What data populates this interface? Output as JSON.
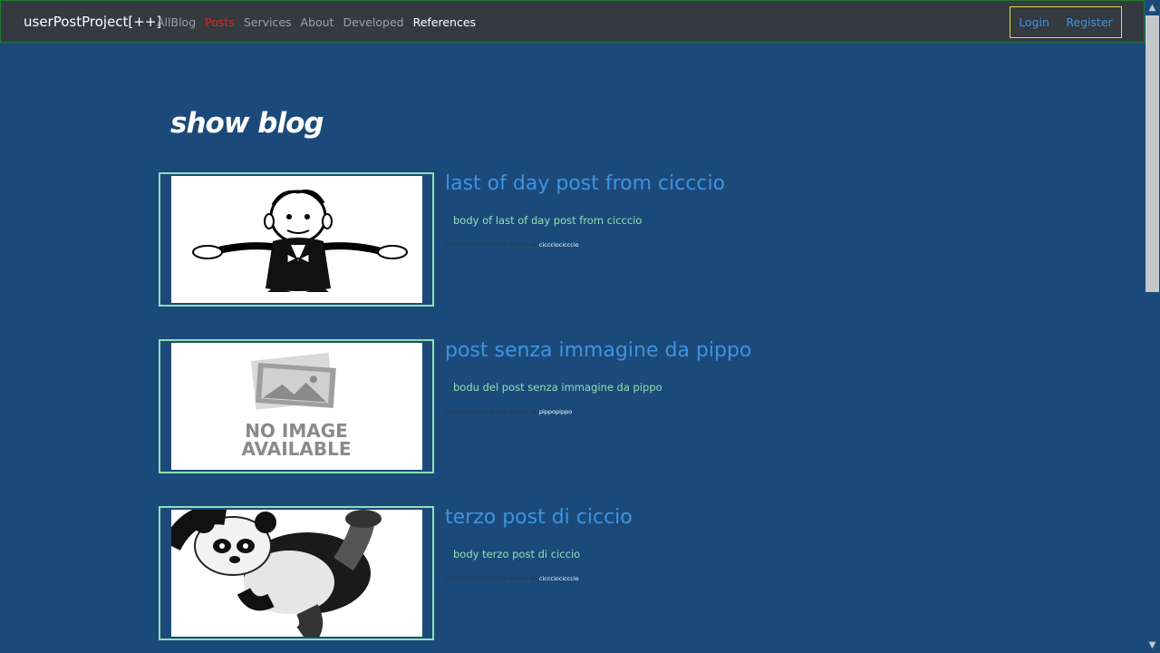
{
  "navbar": {
    "brand": "userPostProject[++]",
    "links": [
      "AllBlog",
      "Posts",
      "Services",
      "About",
      "Developed",
      "References"
    ],
    "login": "Login",
    "register": "Register"
  },
  "page": {
    "title": "show blog"
  },
  "posts": [
    {
      "title": "last of day post from cicccio",
      "body": "body of last of day post from cicccio",
      "date": "2021-01-18 13:06:21 scritto da",
      "author": "ciccciocicccio",
      "image": "cartoon-character"
    },
    {
      "title": "post senza immagine da pippo",
      "body": "bodu del post senza immagine da pippo",
      "date": "2021-01-18 07:47:54 scritto da",
      "author": "pippopippo",
      "image": "no-image-available",
      "no_image_line1": "NO IMAGE",
      "no_image_line2": "AVAILABLE"
    },
    {
      "title": "terzo post di ciccio",
      "body": "body terzo post di ciccio",
      "date": "2021-01-18 07:42:18 scritto da",
      "author": "ciccciocicccio",
      "image": "panda"
    }
  ]
}
